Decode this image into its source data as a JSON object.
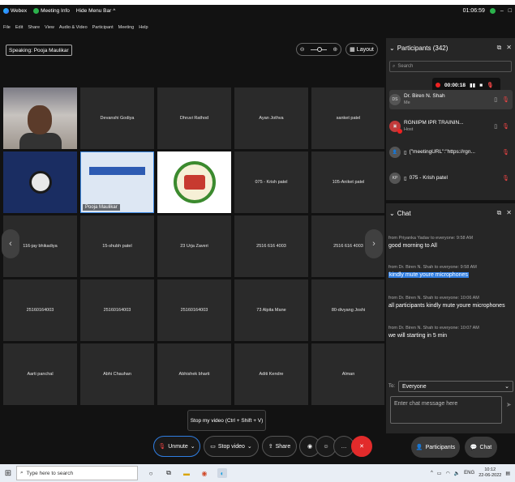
{
  "app": {
    "name": "Webex",
    "meeting_info": "Meeting Info",
    "hide_menu_bar": "Hide Menu Bar",
    "timer": "01:06:59"
  },
  "menu": [
    "File",
    "Edit",
    "Share",
    "View",
    "Audio & Video",
    "Participant",
    "Meeting",
    "Help"
  ],
  "stage": {
    "speaking": "Speaking: Pooja Maulikar",
    "layout_label": "Layout",
    "tiles": [
      {
        "name": "",
        "kind": "face"
      },
      {
        "name": "Devanshi Godiya",
        "kind": "plain"
      },
      {
        "name": "Dhruvi Rathod",
        "kind": "plain"
      },
      {
        "name": "Ayan Jothva",
        "kind": "plain"
      },
      {
        "name": "sanket patel",
        "kind": "plain"
      },
      {
        "name": "",
        "kind": "obs"
      },
      {
        "name": "",
        "kind": "slide",
        "tag": "Pooja Maulikar"
      },
      {
        "name": "",
        "kind": "logo"
      },
      {
        "name": "075 - Krish patel",
        "kind": "plain"
      },
      {
        "name": "105-Aniket patel",
        "kind": "plain"
      },
      {
        "name": "116-jay bhikadiya",
        "kind": "plain"
      },
      {
        "name": "15-shubh patel",
        "kind": "plain"
      },
      {
        "name": "23 Urja Zaveri",
        "kind": "plain"
      },
      {
        "name": "2516 616 4003",
        "kind": "plain"
      },
      {
        "name": "2516 616 4003",
        "kind": "plain"
      },
      {
        "name": "25160164003",
        "kind": "plain"
      },
      {
        "name": "25160164003",
        "kind": "plain"
      },
      {
        "name": "25160164003",
        "kind": "plain"
      },
      {
        "name": "73 Alpita Mane",
        "kind": "plain"
      },
      {
        "name": "80-divyang Joshi",
        "kind": "plain"
      },
      {
        "name": "Aarti panchal",
        "kind": "plain"
      },
      {
        "name": "Abhi Chauhan",
        "kind": "plain"
      },
      {
        "name": "Abhishek bharti",
        "kind": "plain"
      },
      {
        "name": "Aditi Kendre",
        "kind": "plain"
      },
      {
        "name": "Alman",
        "kind": "plain"
      }
    ],
    "tooltip": "Stop my video (Ctrl + Shift + V)"
  },
  "controls": {
    "unmute": "Unmute",
    "stop_video": "Stop video",
    "share": "Share"
  },
  "participants": {
    "title": "Participants (342)",
    "search_placeholder": "Search",
    "recording_time": "00:00:18",
    "list": [
      {
        "initials": "DS",
        "name": "Dr. Biren N. Shah",
        "role": "Me"
      },
      {
        "initials": "",
        "name": "RGNIIPM IPR TRAININ...",
        "role": "Host"
      },
      {
        "initials": "",
        "name": "{\"meetingURL\":\"https://rgn...",
        "role": ""
      },
      {
        "initials": "KP",
        "name": "075 - Krish patel",
        "role": ""
      }
    ]
  },
  "chat": {
    "title": "Chat",
    "messages": [
      {
        "meta": "from Priyanka Yadav to everyone:   9:58 AM",
        "text": "good morning to All",
        "selected": false
      },
      {
        "meta": "from Dr. Biren N. Shah to everyone:   9:58 AM",
        "text": "kindly mute youre microphones",
        "selected": true
      },
      {
        "meta": "from Dr. Biren N. Shah to everyone:   10:06 AM",
        "text": "all participants kindly mute youre microphones",
        "selected": false
      },
      {
        "meta": "from Dr. Biren N. Shah to everyone:   10:07 AM",
        "text": "we will starting in 5 min",
        "selected": false
      }
    ],
    "to_label": "To:",
    "to_value": "Everyone",
    "input_placeholder": "Enter chat message here"
  },
  "side_buttons": {
    "participants": "Participants",
    "chat": "Chat"
  },
  "taskbar": {
    "search_placeholder": "Type here to search",
    "lang": "ENG",
    "time": "10:12",
    "date": "22-06-2022"
  },
  "colors": {
    "accent": "#2f7de1",
    "danger": "#e22b2b",
    "surface": "#262626",
    "background": "#121212"
  }
}
